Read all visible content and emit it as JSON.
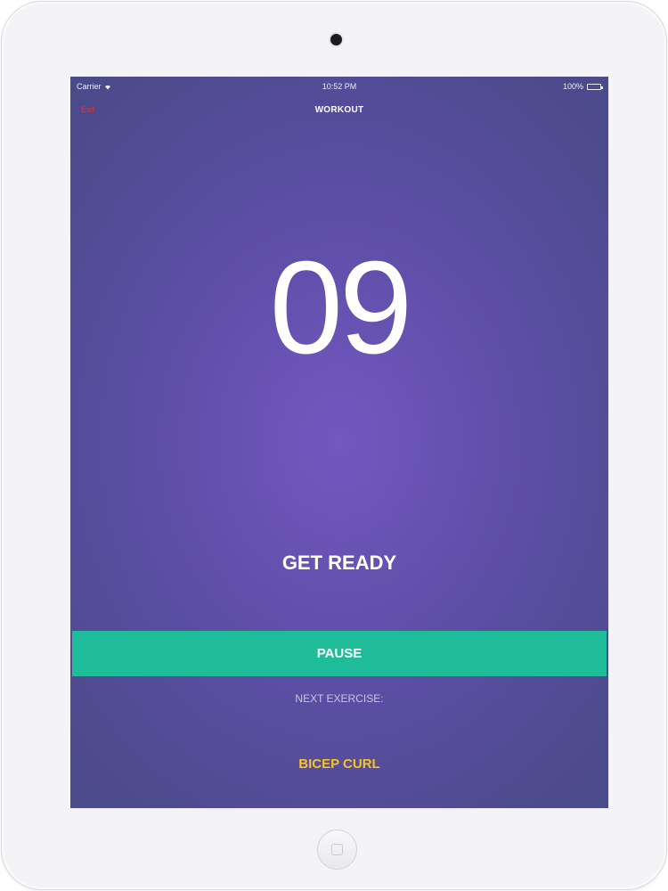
{
  "status_bar": {
    "carrier": "Carrier",
    "time": "10:52 PM",
    "battery": "100%",
    "wifi_icon": "wifi-icon",
    "battery_icon": "battery-icon"
  },
  "nav": {
    "back_label": "Exit",
    "title": "WORKOUT"
  },
  "timer": {
    "countdown": "09"
  },
  "status_message": "GET READY",
  "pause_button": {
    "label": "PAUSE"
  },
  "next": {
    "label": "NEXT EXERCISE:",
    "exercise": "BICEP CURL"
  },
  "colors": {
    "accent": "#1fbc9a",
    "background": "#5f4fa8",
    "highlight": "#f5c424",
    "back_link": "#e0323a"
  }
}
